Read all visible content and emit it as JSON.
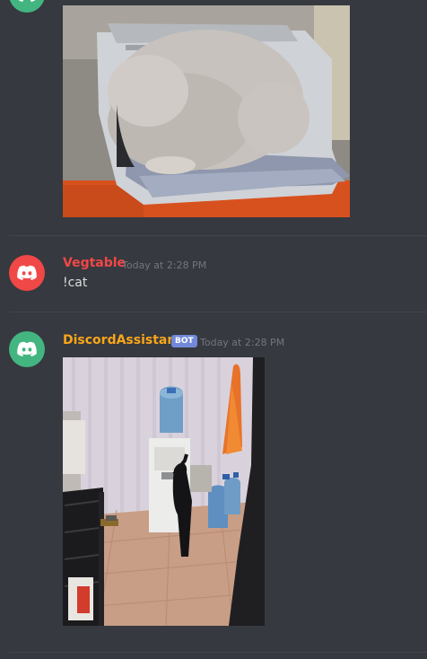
{
  "colors": {
    "background": "#36393f",
    "divider": "#42454a",
    "timestamp": "#72767d",
    "message_text": "#dcddde",
    "bot_badge": "#7289da"
  },
  "messages": [
    {
      "avatar_icon": "discord-logo-icon",
      "avatar_color": "#43b581",
      "attachment": {
        "subject": "cat sitting on a printer"
      }
    },
    {
      "username": "Vegtable",
      "username_color": "#f04747",
      "timestamp": "Today at 2:28 PM",
      "avatar_icon": "discord-logo-icon",
      "avatar_color": "#f04747",
      "text": "!cat"
    },
    {
      "username": "DiscordAssistant",
      "username_color": "#faa61a",
      "bot_badge": "BOT",
      "timestamp": "Today at 2:28 PM",
      "avatar_icon": "discord-logo-icon",
      "avatar_color": "#43b581",
      "attachment": {
        "subject": "black cat pawing at a water cooler"
      }
    }
  ]
}
